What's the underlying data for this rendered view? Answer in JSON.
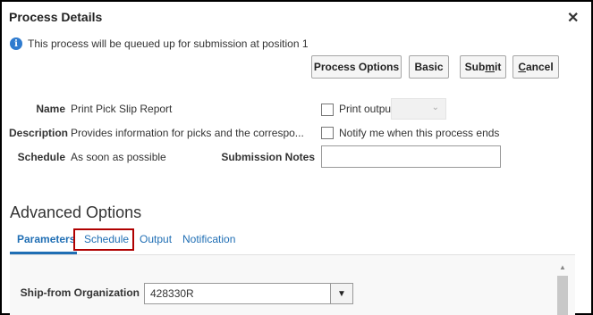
{
  "dialog": {
    "title": "Process Details",
    "close_glyph": "✕",
    "info_message": "This process will be queued up for submission at position 1",
    "info_icon_glyph": "i"
  },
  "buttons": {
    "process_options": "Process Options",
    "basic": "Basic",
    "submit_pre": "Sub",
    "submit_key": "m",
    "submit_post": "it",
    "cancel_key": "C",
    "cancel_post": "ancel"
  },
  "details": {
    "name_label": "Name",
    "name_value": "Print Pick Slip Report",
    "description_label": "Description",
    "description_value": "Provides information for picks and the correspo...",
    "schedule_label": "Schedule",
    "schedule_value": "As soon as possible",
    "submission_notes_label": "Submission Notes",
    "submission_notes_value": ""
  },
  "options": {
    "print_output_label": "Print output",
    "notify_label": "Notify me when this process ends",
    "print_output_checked": false,
    "notify_checked": false
  },
  "advanced": {
    "title": "Advanced Options",
    "tabs": [
      {
        "label": "Parameters",
        "active": true
      },
      {
        "label": "Schedule",
        "active": false,
        "highlighted": true
      },
      {
        "label": "Output",
        "active": false
      },
      {
        "label": "Notification",
        "active": false
      }
    ]
  },
  "parameters": {
    "ship_from_label": "Ship-from Organization",
    "ship_from_value": "428330R"
  },
  "colors": {
    "accent": "#1f6eb4",
    "highlight_border": "#b00000",
    "info_icon": "#2e7bcf"
  }
}
